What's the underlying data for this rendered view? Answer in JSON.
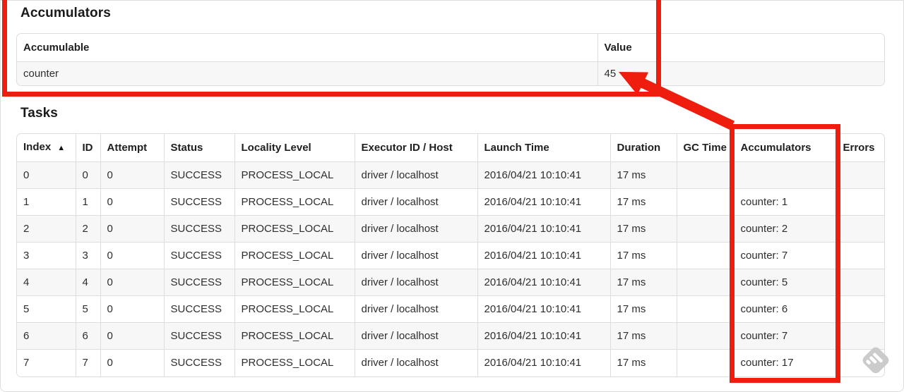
{
  "page": {
    "accumulators_section": {
      "heading": "Accumulators",
      "table": {
        "columns": [
          "Accumulable",
          "Value"
        ],
        "rows": [
          [
            "counter",
            "45"
          ]
        ]
      }
    },
    "tasks_section": {
      "heading": "Tasks",
      "table": {
        "columns": [
          "Index",
          "ID",
          "Attempt",
          "Status",
          "Locality Level",
          "Executor ID / Host",
          "Launch Time",
          "Duration",
          "GC Time",
          "Accumulators",
          "Errors"
        ],
        "sort_column": "Index",
        "sort_indicator": "▲",
        "rows": [
          [
            "0",
            "0",
            "0",
            "SUCCESS",
            "PROCESS_LOCAL",
            "driver / localhost",
            "2016/04/21 10:10:41",
            "17 ms",
            "",
            "",
            ""
          ],
          [
            "1",
            "1",
            "0",
            "SUCCESS",
            "PROCESS_LOCAL",
            "driver / localhost",
            "2016/04/21 10:10:41",
            "17 ms",
            "",
            "counter: 1",
            ""
          ],
          [
            "2",
            "2",
            "0",
            "SUCCESS",
            "PROCESS_LOCAL",
            "driver / localhost",
            "2016/04/21 10:10:41",
            "17 ms",
            "",
            "counter: 2",
            ""
          ],
          [
            "3",
            "3",
            "0",
            "SUCCESS",
            "PROCESS_LOCAL",
            "driver / localhost",
            "2016/04/21 10:10:41",
            "17 ms",
            "",
            "counter: 7",
            ""
          ],
          [
            "4",
            "4",
            "0",
            "SUCCESS",
            "PROCESS_LOCAL",
            "driver / localhost",
            "2016/04/21 10:10:41",
            "17 ms",
            "",
            "counter: 5",
            ""
          ],
          [
            "5",
            "5",
            "0",
            "SUCCESS",
            "PROCESS_LOCAL",
            "driver / localhost",
            "2016/04/21 10:10:41",
            "17 ms",
            "",
            "counter: 6",
            ""
          ],
          [
            "6",
            "6",
            "0",
            "SUCCESS",
            "PROCESS_LOCAL",
            "driver / localhost",
            "2016/04/21 10:10:41",
            "17 ms",
            "",
            "counter: 7",
            ""
          ],
          [
            "7",
            "7",
            "0",
            "SUCCESS",
            "PROCESS_LOCAL",
            "driver / localhost",
            "2016/04/21 10:10:41",
            "17 ms",
            "",
            "counter: 17",
            ""
          ]
        ]
      }
    },
    "annotations": {
      "color": "#ee1d0d",
      "boxes": [
        "accumulators-section-highlight",
        "accumulators-column-highlight"
      ],
      "arrow": "accumulators-column-to-value-arrow"
    },
    "watermark": {
      "icon": "feedly-icon",
      "color": "#c9c9c9"
    }
  }
}
